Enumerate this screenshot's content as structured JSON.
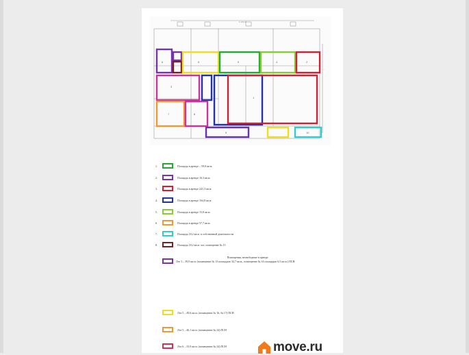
{
  "legend": [
    {
      "num": "1.",
      "color": "#22aa33",
      "text": "Площадь в аренде – 59,8 кв.м."
    },
    {
      "num": "2.",
      "color": "#7733aa",
      "text": "Площадь в аренде 16,3 кв.м."
    },
    {
      "num": "3.",
      "color": "#cc2233",
      "text": "Площадь в аренде 241,3 кв.м."
    },
    {
      "num": "4.",
      "color": "#2233aa",
      "text": "Площадь в аренде 164,8 кв.м."
    },
    {
      "num": "5.",
      "color": "#88cc33",
      "text": "Площадь в аренде 15,8 кв.м."
    },
    {
      "num": "6.",
      "color": "#ee9933",
      "text": "Площадь в аренде 57,7 кв.м."
    },
    {
      "num": "7.",
      "color": "#33cccc",
      "text": "Площадь 18,2 кв.м. в собственной деятельности"
    },
    {
      "num": "8.",
      "color": "#772222",
      "text": "Площадь 18,2 кв.м. хоз. помещение № 15"
    },
    {
      "num": "",
      "color": "#7733aa",
      "text": ""
    },
    {
      "num": "",
      "color": "#eedd22",
      "text": "Лот 5 – 49,6 кв.м. (помещение № 16, № 17) ПСН"
    },
    {
      "num": "",
      "color": "#ee9933",
      "text": "Лот 5 – 46,1 кв.м. (помещение № 24) ПСН"
    },
    {
      "num": "",
      "color": "#cc3355",
      "text": "Лот 6 – 33,9 кв.м. (помещение № 24) ПСН"
    }
  ],
  "note": {
    "heading": "Помещения, несвободные в аренде:",
    "text": "Лот 1 – 39,9 кв.м. (помещение № 13 площадью 32,7 кв.м., помещение № 14 площадью 6,5 кв.м.) ПСН"
  },
  "plan": {
    "scale_label": "1:100 Ø",
    "room_marks": [
      "6",
      "5",
      "5",
      "4",
      "2",
      "3",
      "1",
      "7",
      "8",
      "9",
      "10"
    ]
  },
  "logo": {
    "text": "move.ru",
    "color": "#f07b1e"
  }
}
